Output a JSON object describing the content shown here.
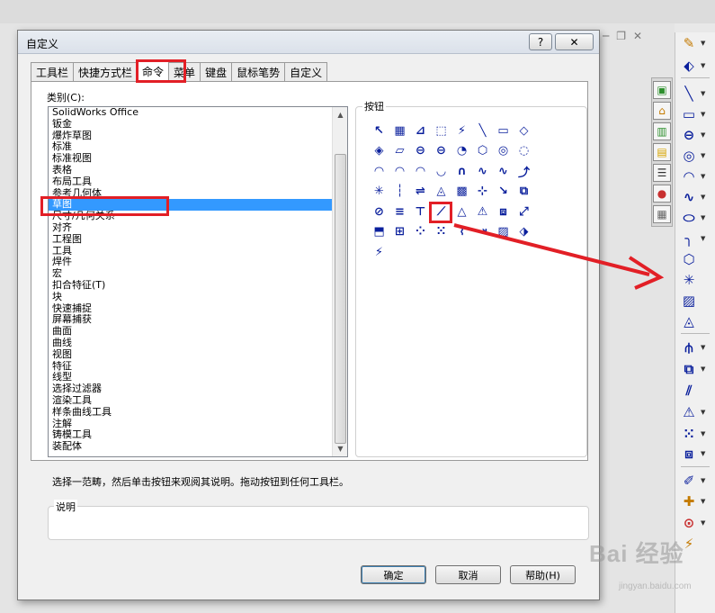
{
  "dialog": {
    "title": "自定义",
    "help_btn": "?",
    "close_btn": "✕",
    "tabs": [
      {
        "label": "工具栏",
        "active": false
      },
      {
        "label": "快捷方式栏",
        "active": false
      },
      {
        "label": "命令",
        "active": true
      },
      {
        "label": "菜单",
        "active": false
      },
      {
        "label": "键盘",
        "active": false
      },
      {
        "label": "鼠标笔势",
        "active": false
      },
      {
        "label": "自定义",
        "active": false
      }
    ],
    "category_label": "类别(C):",
    "categories": [
      "SolidWorks Office",
      "钣金",
      "爆炸草图",
      "标准",
      "标准视图",
      "表格",
      "布局工具",
      "参考几何体",
      "草图",
      "尺寸/几何关系",
      "对齐",
      "工程图",
      "工具",
      "焊件",
      "宏",
      "扣合特征(T)",
      "块",
      "快速捕捉",
      "屏幕捕获",
      "曲面",
      "曲线",
      "视图",
      "特征",
      "线型",
      "选择过滤器",
      "渲染工具",
      "样条曲线工具",
      "注解",
      "铸模工具",
      "装配体"
    ],
    "selected_category": "草图",
    "buttons_label": "按钮",
    "hint": "选择一范畴，然后单击按钮来观阅其说明。拖动按钮到任何工具栏。",
    "description_label": "说明",
    "ok_button": "确定",
    "cancel_button": "取消",
    "help_button": "帮助(H)",
    "icon_rows": [
      [
        "↖",
        "▦",
        "⊿",
        "⬚",
        "⚡",
        "╲",
        "▭",
        "◇"
      ],
      [
        "◈",
        "▱",
        "⊖",
        "⊖",
        "◔",
        "⬡",
        "◎",
        "◌"
      ],
      [
        "◠",
        "◠",
        "◠",
        "◡",
        "∩",
        "∿",
        "∿",
        "⤴"
      ],
      [
        "✳",
        "┆",
        "⇌",
        "◬",
        "▩",
        "⊹",
        "↘",
        "⧉"
      ],
      [
        "⊘",
        "≡",
        "⊤",
        "⟋",
        "△",
        "⚠",
        "⧈",
        "⤢"
      ],
      [
        "⬒",
        "⊞",
        "⁘",
        "⁙",
        "⌇",
        "⇥",
        "▨",
        "⬗"
      ],
      [
        "⚡"
      ]
    ]
  },
  "right_toolbar": {
    "icons": [
      "sketch-icon",
      "smart-dim-icon",
      "line-icon",
      "rectangle-icon",
      "slot-icon",
      "circle-icon",
      "arc-icon",
      "spline-icon",
      "ellipse-icon",
      "fillet-icon",
      "polygon-icon",
      "point-icon",
      "plane-icon",
      "text-icon",
      "trim-icon",
      "offset-icon",
      "mirror-icon",
      "relation-icon",
      "pattern-icon",
      "move-icon",
      "repair-icon",
      "quick-snap-icon",
      "snap-icon",
      "dimension-icon"
    ]
  },
  "watermark": {
    "text": "Bai 经验",
    "sub": "jingyan.baidu.com"
  },
  "colors": {
    "selection": "#3399ff",
    "highlight": "#e21f26",
    "icon_blue": "#0a1f9c"
  }
}
